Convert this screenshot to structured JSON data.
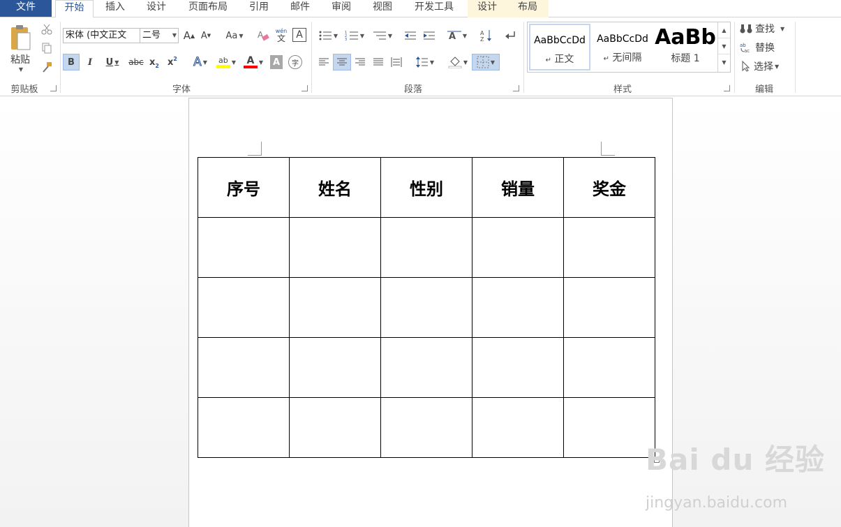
{
  "tabs": {
    "file": "文件",
    "home": "开始",
    "insert": "插入",
    "design": "设计",
    "layout": "页面布局",
    "references": "引用",
    "mailings": "邮件",
    "review": "审阅",
    "view": "视图",
    "developer": "开发工具",
    "table_design": "设计",
    "table_layout": "布局"
  },
  "clipboard": {
    "paste": "粘贴",
    "label": "剪贴板"
  },
  "font": {
    "name": "宋体 (中文正文",
    "size": "二号",
    "bold": "B",
    "italic": "I",
    "underline": "U",
    "strike": "abc",
    "subscript_base": "x",
    "subscript_mark": "2",
    "superscript_base": "x",
    "superscript_mark": "2",
    "grow": "A",
    "shrink": "A",
    "case": "Aa",
    "phonetic_top": "wén",
    "phonetic_bottom": "文",
    "border_char": "A",
    "effects": "A",
    "highlight": "ab",
    "color": "A",
    "shade": "A",
    "enclose": "字",
    "label": "字体"
  },
  "paragraph": {
    "label": "段落"
  },
  "styles": {
    "label": "样式",
    "items": [
      {
        "preview": "AaBbCcDd",
        "name": "正文"
      },
      {
        "preview": "AaBbCcDd",
        "name": "无间隔"
      },
      {
        "preview": "AaBb",
        "name": "标题 1"
      }
    ]
  },
  "editing": {
    "find": "查找",
    "replace": "替换",
    "select": "选择",
    "label": "编辑"
  },
  "table": {
    "headers": [
      "序号",
      "姓名",
      "性别",
      "销量",
      "奖金"
    ],
    "rows": [
      [
        "",
        "",
        "",
        "",
        ""
      ],
      [
        "",
        "",
        "",
        "",
        ""
      ],
      [
        "",
        "",
        "",
        "",
        ""
      ],
      [
        "",
        "",
        "",
        "",
        ""
      ]
    ]
  },
  "watermark": {
    "brand": "Bai du 经验",
    "url": "jingyan.baidu.com"
  },
  "colors": {
    "accent": "#2b579a",
    "highlight": "#ffff00",
    "font_color": "#ff0000"
  }
}
